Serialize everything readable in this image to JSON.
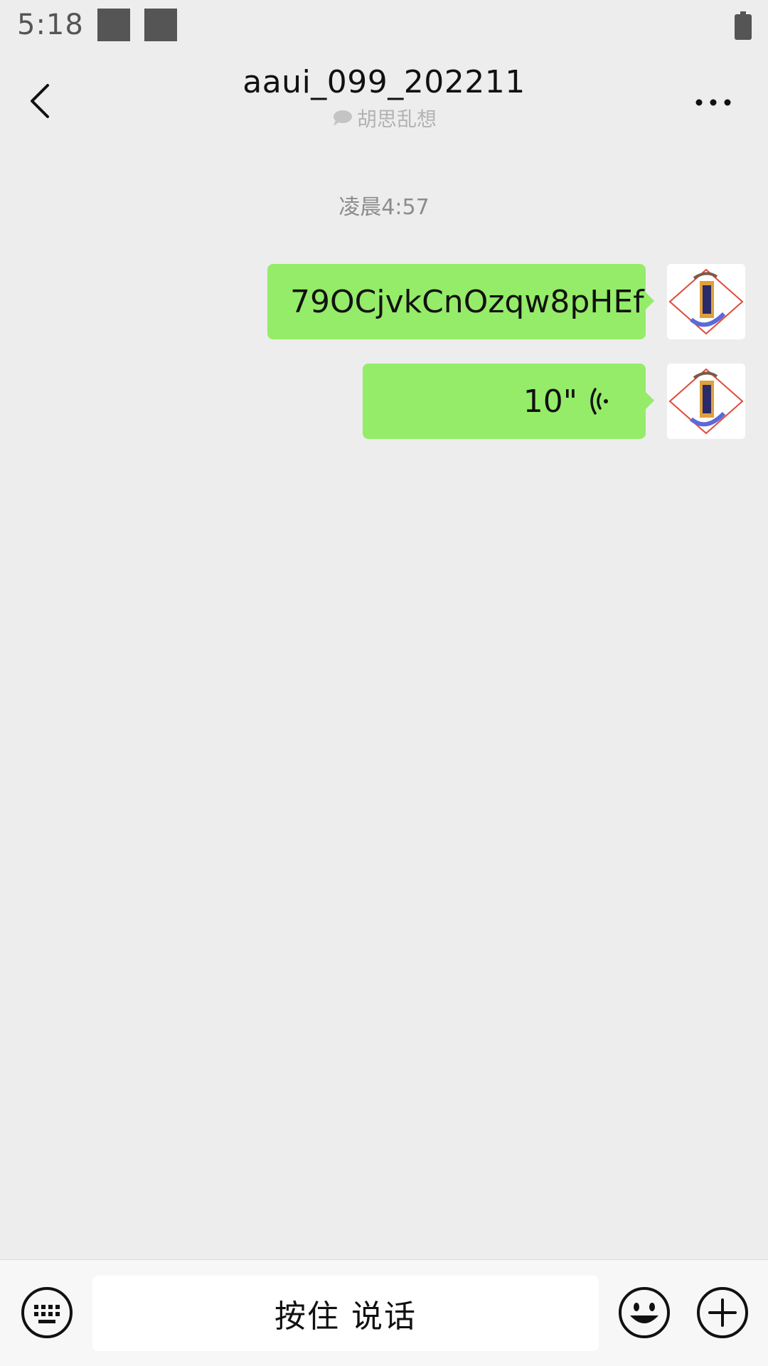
{
  "status_bar": {
    "time": "5:18"
  },
  "header": {
    "title": "aaui_099_202211",
    "subtitle": "胡思乱想",
    "back_icon": "chevron-left-icon",
    "more_icon": "more-dots-icon"
  },
  "chat": {
    "timestamp": "凌晨4:57",
    "messages": [
      {
        "type": "text",
        "text": "79OCjvkCnOzqw8pHEf"
      },
      {
        "type": "voice",
        "duration": "10\""
      }
    ]
  },
  "input_bar": {
    "hold_to_talk": "按住 说话",
    "keyboard_icon": "keyboard-icon",
    "emoji_icon": "smiley-icon",
    "plus_icon": "plus-circle-icon"
  },
  "colors": {
    "background": "#ededed",
    "bubble": "#95ec69",
    "input_bar": "#f7f7f7"
  }
}
